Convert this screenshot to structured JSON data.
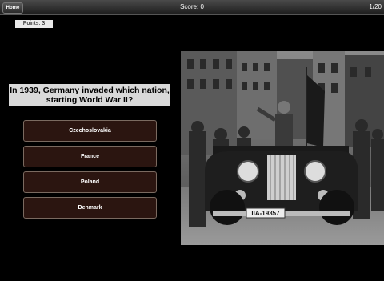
{
  "toolbar": {
    "home_label": "Home",
    "score_label": "Score: 0",
    "progress_label": "1/20"
  },
  "points_label": "Points: 3",
  "question": "In 1939, Germany invaded which nation, starting World War II?",
  "answers": [
    {
      "label": "Czechoslovakia"
    },
    {
      "label": "France"
    },
    {
      "label": "Poland"
    },
    {
      "label": "Denmark"
    }
  ],
  "photo": {
    "plate_text": "IIA-19357"
  }
}
